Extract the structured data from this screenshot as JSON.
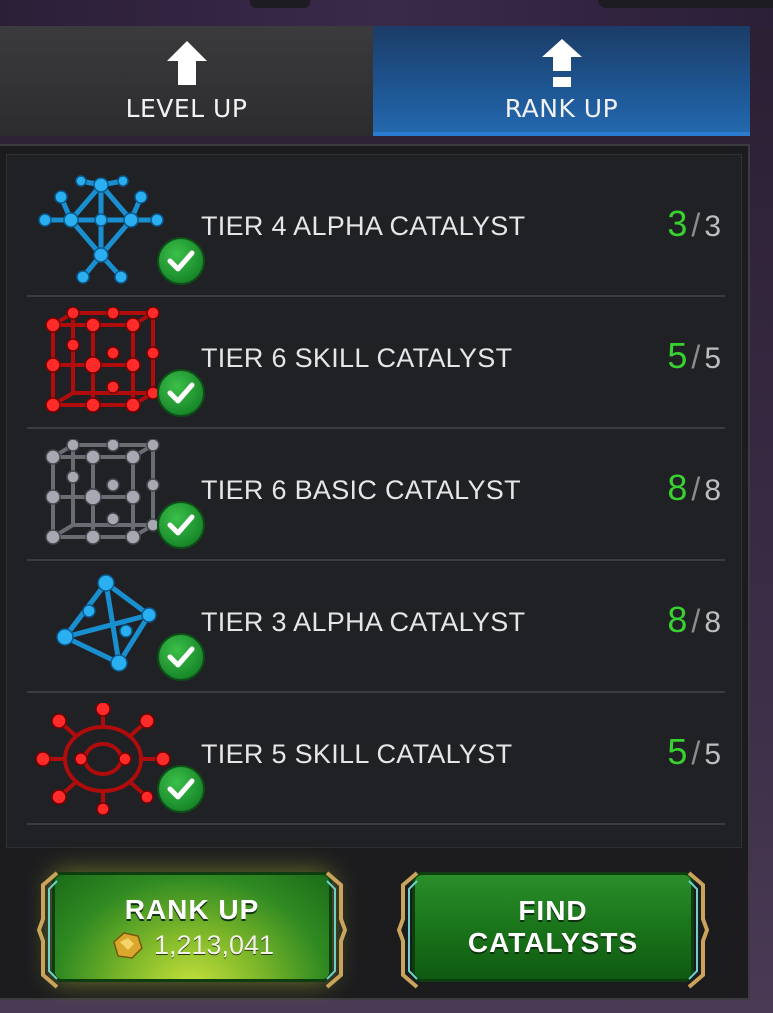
{
  "tabs": {
    "level_up": "LEVEL UP",
    "rank_up": "RANK UP",
    "active": "rank_up"
  },
  "catalysts": [
    {
      "name": "TIER 4 ALPHA CATALYST",
      "have": "3",
      "need": "3",
      "color": "#1aa0e6",
      "icon": "alpha-catalyst-large-icon"
    },
    {
      "name": "TIER 6 SKILL CATALYST",
      "have": "5",
      "need": "5",
      "color": "#e01a1a",
      "icon": "skill-catalyst-cubic-icon"
    },
    {
      "name": "TIER 6 BASIC CATALYST",
      "have": "8",
      "need": "8",
      "color": "#8a8c95",
      "icon": "basic-catalyst-cubic-icon"
    },
    {
      "name": "TIER 3 ALPHA CATALYST",
      "have": "8",
      "need": "8",
      "color": "#1aa0e6",
      "icon": "alpha-catalyst-small-icon"
    },
    {
      "name": "TIER 5 SKILL CATALYST",
      "have": "5",
      "need": "5",
      "color": "#e01a1a",
      "icon": "skill-catalyst-ring-icon"
    }
  ],
  "buttons": {
    "rank_up_label": "RANK UP",
    "rank_up_cost": "1,213,041",
    "find_line1": "FIND",
    "find_line2": "CATALYSTS"
  },
  "colors": {
    "have": "#39d12f",
    "need": "#bdbdbd",
    "rank_tab": "#1f5a9a",
    "button_green": "#197219"
  }
}
